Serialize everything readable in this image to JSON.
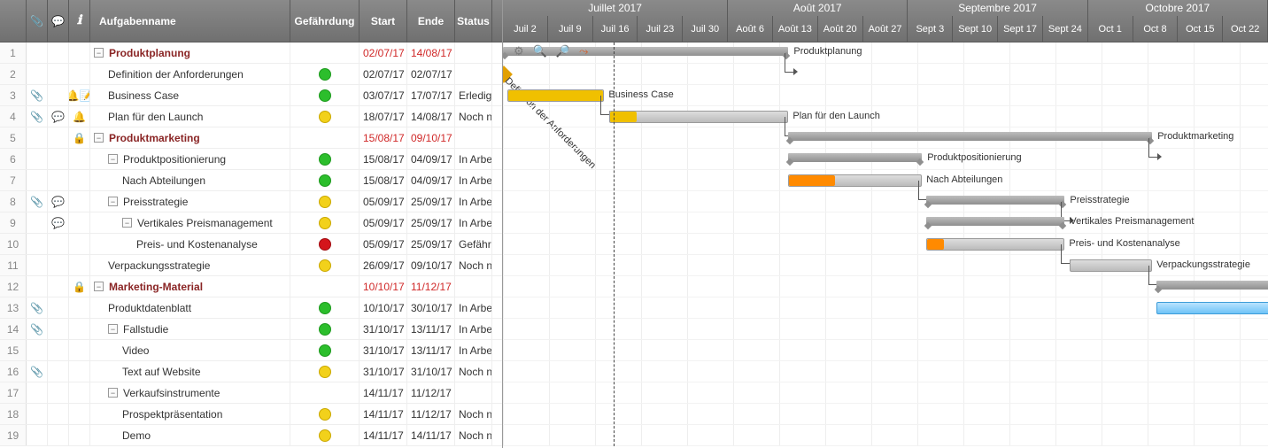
{
  "columns": {
    "num": "",
    "clip": "",
    "comment": "",
    "info": "ℹ",
    "name": "Aufgabenname",
    "risk": "Gefährdung",
    "start": "Start",
    "end": "Ende",
    "status": "Status"
  },
  "months": [
    {
      "label": "Juillet 2017",
      "weeks": 5
    },
    {
      "label": "Août 2017",
      "weeks": 4
    },
    {
      "label": "Septembre 2017",
      "weeks": 4
    },
    {
      "label": "Octobre 2017",
      "weeks": 4
    }
  ],
  "weeks": [
    "Juil 2",
    "Juil 9",
    "Juil 16",
    "Juil 23",
    "Juil 30",
    "Août 6",
    "Août 13",
    "Août 20",
    "Août 27",
    "Sept 3",
    "Sept 10",
    "Sept 17",
    "Sept 24",
    "Oct 1",
    "Oct 8",
    "Oct 15",
    "Oct 22"
  ],
  "today_index": 2.4,
  "risk_colors": {
    "green": "#2cbe2c",
    "yellow": "#f2d11b",
    "red": "#d4151b"
  },
  "rows": [
    {
      "n": 1,
      "indent": 0,
      "toggle": "−",
      "parent": true,
      "name": "Produktplanung",
      "start": "02/07/17",
      "end": "14/08/17",
      "bar": {
        "type": "summary",
        "from": 0,
        "to": 6.2,
        "label": "Produktplanung"
      }
    },
    {
      "n": 2,
      "indent": 1,
      "name": "Definition der Anforderungen",
      "risk": "green",
      "start": "02/07/17",
      "end": "02/07/17",
      "bar": {
        "type": "milestone",
        "from": 0,
        "label": "Definition der Anforderungen"
      }
    },
    {
      "n": 3,
      "indent": 1,
      "clip": true,
      "bell": true,
      "note": true,
      "name": "Business Case",
      "risk": "green",
      "start": "03/07/17",
      "end": "17/07/17",
      "status": "Erledigt",
      "bar": {
        "type": "task",
        "from": 0.1,
        "to": 2.2,
        "prog": 1,
        "label": "Business Case",
        "color": "yellow"
      }
    },
    {
      "n": 4,
      "indent": 1,
      "clip": true,
      "comment": true,
      "bell": true,
      "name": "Plan für den Launch",
      "risk": "yellow",
      "start": "18/07/17",
      "end": "14/08/17",
      "status": "Noch nicht begonnen",
      "bar": {
        "type": "task",
        "from": 2.3,
        "to": 6.2,
        "prog": 0.15,
        "label": "Plan für den Launch",
        "color": "yellow"
      }
    },
    {
      "n": 5,
      "indent": 0,
      "toggle": "−",
      "parent": true,
      "lock": true,
      "name": "Produktmarketing",
      "start": "15/08/17",
      "end": "09/10/17",
      "bar": {
        "type": "summary",
        "from": 6.2,
        "to": 14.1,
        "label": "Produktmarketing"
      }
    },
    {
      "n": 6,
      "indent": 1,
      "toggle": "−",
      "name": "Produktpositionierung",
      "risk": "green",
      "start": "15/08/17",
      "end": "04/09/17",
      "status": "In Arbeit",
      "bar": {
        "type": "summary",
        "from": 6.2,
        "to": 9.1,
        "label": "Produktpositionierung"
      }
    },
    {
      "n": 7,
      "indent": 2,
      "name": "Nach Abteilungen",
      "risk": "green",
      "start": "15/08/17",
      "end": "04/09/17",
      "status": "In Arbeit",
      "bar": {
        "type": "task",
        "from": 6.2,
        "to": 9.1,
        "prog": 0.35,
        "label": "Nach Abteilungen",
        "color": "orange"
      }
    },
    {
      "n": 8,
      "indent": 1,
      "toggle": "−",
      "clip": true,
      "comment": true,
      "name": "Preisstrategie",
      "risk": "yellow",
      "start": "05/09/17",
      "end": "25/09/17",
      "status": "In Arbeit",
      "bar": {
        "type": "summary",
        "from": 9.2,
        "to": 12.2,
        "label": "Preisstrategie"
      }
    },
    {
      "n": 9,
      "indent": 2,
      "toggle": "−",
      "comment": true,
      "name": "Vertikales Preismanagement",
      "risk": "yellow",
      "start": "05/09/17",
      "end": "25/09/17",
      "status": "In Arbeit",
      "bar": {
        "type": "summary",
        "from": 9.2,
        "to": 12.2,
        "label": "Vertikales Preismanagement"
      }
    },
    {
      "n": 10,
      "indent": 3,
      "name": "Preis- und Kostenanalyse",
      "risk": "red",
      "start": "05/09/17",
      "end": "25/09/17",
      "status": "Gefährdet",
      "bar": {
        "type": "task",
        "from": 9.2,
        "to": 12.2,
        "prog": 0.12,
        "label": "Preis- und Kostenanalyse",
        "color": "orange"
      }
    },
    {
      "n": 11,
      "indent": 1,
      "name": "Verpackungsstrategie",
      "risk": "yellow",
      "start": "26/09/17",
      "end": "09/10/17",
      "status": "Noch nicht begonnen",
      "bar": {
        "type": "task",
        "from": 12.3,
        "to": 14.1,
        "prog": 0,
        "label": "Verpackungsstrategie",
        "color": "orange"
      }
    },
    {
      "n": 12,
      "indent": 0,
      "toggle": "−",
      "parent": true,
      "lock": true,
      "name": "Marketing-Material",
      "start": "10/10/17",
      "end": "11/12/17",
      "bar": {
        "type": "summary",
        "from": 14.2,
        "to": 20,
        "label": ""
      }
    },
    {
      "n": 13,
      "indent": 1,
      "clip": true,
      "name": "Produktdatenblatt",
      "risk": "green",
      "start": "10/10/17",
      "end": "30/10/17",
      "status": "In Arbeit",
      "bar": {
        "type": "task",
        "from": 14.2,
        "to": 17.2,
        "prog": 0,
        "label": "",
        "sel": true
      }
    },
    {
      "n": 14,
      "indent": 1,
      "toggle": "−",
      "clip": true,
      "name": "Fallstudie",
      "risk": "green",
      "start": "31/10/17",
      "end": "13/11/17",
      "status": "In Arbeit"
    },
    {
      "n": 15,
      "indent": 2,
      "name": "Video",
      "risk": "green",
      "start": "31/10/17",
      "end": "13/11/17",
      "status": "In Arbeit"
    },
    {
      "n": 16,
      "indent": 2,
      "clip": true,
      "name": "Text auf Website",
      "risk": "yellow",
      "start": "31/10/17",
      "end": "31/10/17",
      "status": "Noch nicht begonnen"
    },
    {
      "n": 17,
      "indent": 1,
      "toggle": "−",
      "name": "Verkaufsinstrumente",
      "start": "14/11/17",
      "end": "11/12/17"
    },
    {
      "n": 18,
      "indent": 2,
      "name": "Prospektpräsentation",
      "risk": "yellow",
      "start": "14/11/17",
      "end": "11/12/17",
      "status": "Noch nicht begonnen"
    },
    {
      "n": 19,
      "indent": 2,
      "name": "Demo",
      "risk": "yellow",
      "start": "14/11/17",
      "end": "14/11/17",
      "status": "Noch nicht begonnen"
    }
  ]
}
